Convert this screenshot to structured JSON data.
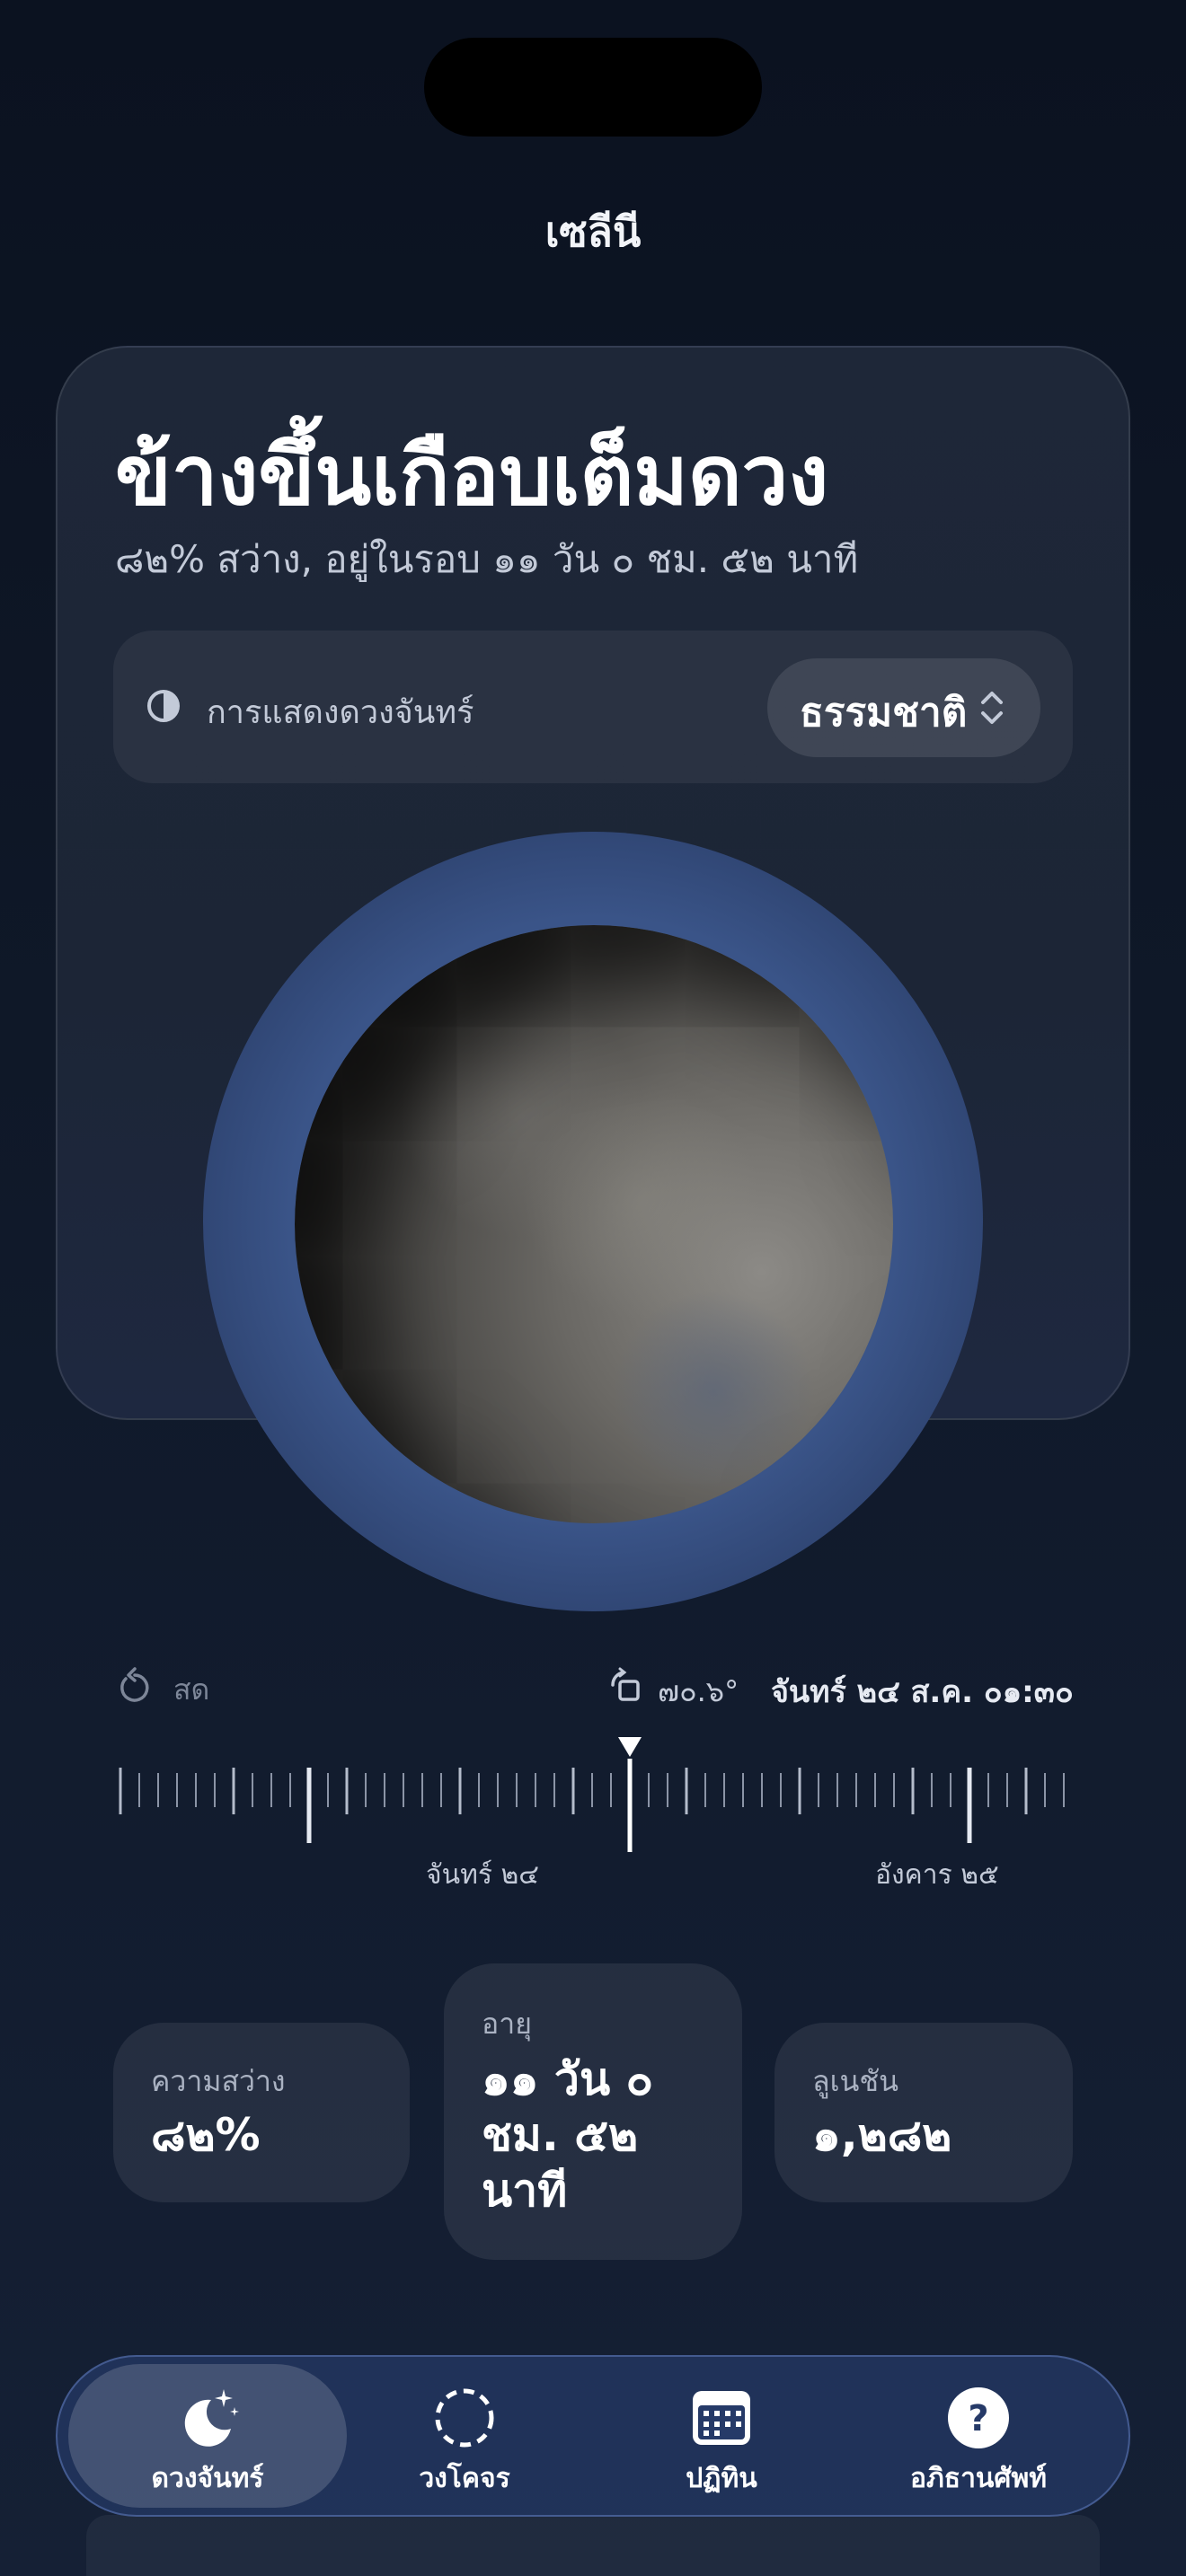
{
  "app": {
    "title": "เซลีนี"
  },
  "phase": {
    "name": "ข้างขึ้นเกือบเต็มดวง",
    "subtitle": "๘๒% สว่าง, อยู่ในรอบ ๑๑ วัน ๐ ชม. ๕๒ นาที"
  },
  "display": {
    "icon": "half-circle-icon",
    "label": "การแสดงดวงจันทร์",
    "selected": "ธรรมชาติ",
    "selector_icon": "chevron-up-down-icon"
  },
  "timeline": {
    "live_icon": "refresh-icon",
    "live_label": "สด",
    "rotation_icon": "rotate-icon",
    "rotation": "๗๐.๖°",
    "current_datetime": "จันทร์ ๒๔ ส.ค. ๐๑:๓๐",
    "day_labels": [
      "จันทร์ ๒๔",
      "อังคาร ๒๕"
    ]
  },
  "stats": {
    "illumination": {
      "label": "ความสว่าง",
      "value": "๘๒%"
    },
    "age": {
      "label": "อายุ",
      "line1": "๑๑ วัน ๐",
      "line2": "ชม. ๕๒",
      "line3": "นาที"
    },
    "lunation": {
      "label": "ลูเนชัน",
      "value": "๑,๒๘๒"
    }
  },
  "tabs": [
    {
      "label": "ดวงจันทร์",
      "icon": "moon-stars-icon",
      "active": true
    },
    {
      "label": "วงโคจร",
      "icon": "orbit-icon",
      "active": false
    },
    {
      "label": "ปฏิทิน",
      "icon": "calendar-icon",
      "active": false
    },
    {
      "label": "อภิธานศัพท์",
      "icon": "question-icon",
      "active": false
    }
  ],
  "colors": {
    "background": "#0f1828",
    "card": "#1e2738",
    "halo": "#3a5488",
    "tabbar": "#263a68",
    "text_secondary": "#c3cad8"
  }
}
